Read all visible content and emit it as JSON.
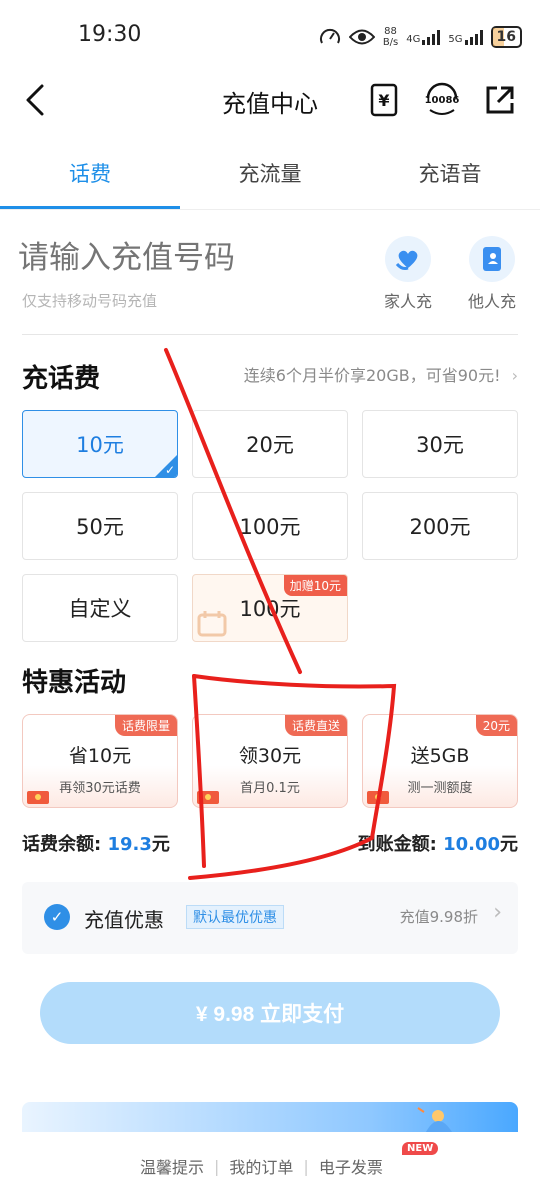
{
  "status_bar": {
    "time": "19:30",
    "net_speed_value": "88",
    "net_speed_unit": "B/s",
    "signal1": "4G",
    "signal2": "5G",
    "battery": "16"
  },
  "header": {
    "title": "充值中心",
    "bill_icon_glyph": "¥",
    "service_icon_text": "10086"
  },
  "tabs": [
    {
      "label": "话费"
    },
    {
      "label": "充流量"
    },
    {
      "label": "充语音"
    }
  ],
  "phone": {
    "placeholder": "请输入充值号码",
    "hint": "仅支持移动号码充值",
    "family_label": "家人充",
    "others_label": "他人充"
  },
  "topup": {
    "title": "充话费",
    "promo": "连续6个月半价享20GB，可省90元!",
    "amounts": [
      "10元",
      "20元",
      "30元",
      "50元",
      "100元",
      "200元",
      "自定义",
      "100元"
    ],
    "gift_badge": "加赠10元",
    "selected_index": 0
  },
  "activities": {
    "title": "特惠活动",
    "items": [
      {
        "badge": "话费限量",
        "title": "省10元",
        "sub": "再领30元话费"
      },
      {
        "badge": "话费直送",
        "title": "领30元",
        "sub": "首月0.1元"
      },
      {
        "badge": "20元",
        "title": "送5GB",
        "sub": "测一测额度"
      }
    ]
  },
  "balance": {
    "label": "话费余额:",
    "value": "19.3",
    "unit": "元",
    "arrive_label": "到账金额:",
    "arrive_value": "10.00",
    "arrive_unit": "元"
  },
  "discount": {
    "title": "充值优惠",
    "tag": "默认最优优惠",
    "right": "充值9.98折"
  },
  "pay": {
    "label": "¥ 9.98  立即支付"
  },
  "footer": {
    "tips": "温馨提示",
    "orders": "我的订单",
    "invoice": "电子发票",
    "new_badge": "NEW"
  },
  "colors": {
    "accent": "#1e8fe8",
    "badge_red": "#ef5e4a",
    "annotation_red": "#e8201c"
  }
}
